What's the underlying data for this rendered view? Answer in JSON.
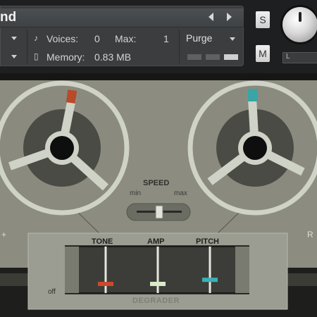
{
  "header": {
    "instrument_name": "nd",
    "voices_label": "Voices:",
    "voices_value": "0",
    "max_label": "Max:",
    "max_value": "1",
    "memory_label": "Memory:",
    "memory_value": "0.83 MB",
    "purge_label": "Purge",
    "solo_label": "S",
    "mute_label": "M",
    "volume_label": "L"
  },
  "deck": {
    "speed_label": "SPEED",
    "speed_min": "min",
    "speed_max": "max",
    "speed_value": 0.5,
    "left_side_label": "+",
    "right_side_label": "R",
    "reel_left_marker_color": "#b84a2a",
    "reel_right_marker_color": "#3aa5a5"
  },
  "degrader": {
    "title": "DEGRADER",
    "off_label": "off",
    "faders": [
      {
        "label": "TONE",
        "color": "#d0482c",
        "value": 0.12
      },
      {
        "label": "AMP",
        "color": "#d8ecc8",
        "value": 0.12
      },
      {
        "label": "PITCH",
        "color": "#3ab0b8",
        "value": 0.22
      }
    ]
  }
}
